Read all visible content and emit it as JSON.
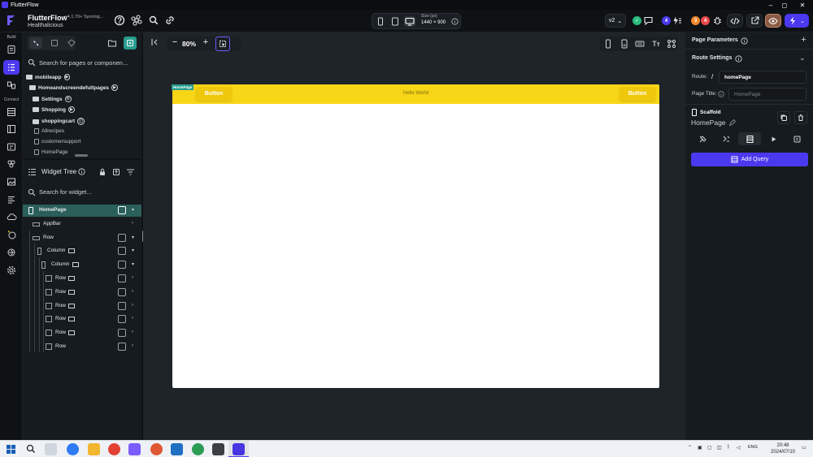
{
  "window": {
    "title": "FlutterFlow",
    "minimize": "–",
    "maximize": "◻",
    "close": "✕"
  },
  "topbar": {
    "brand": "FlutterFlow",
    "version": "v4.1.70+",
    "status": "Syncing...",
    "project": "Healthalicious",
    "size_label": "Size (px)",
    "size_value": "1440 × 900",
    "branch": "v2",
    "badge_1": "4",
    "badge_2": "3",
    "badge_3": "4",
    "colors": {
      "accent": "#4b39ef",
      "green": "#2bbd7e",
      "orange": "#f0892e",
      "red": "#e84a4a"
    }
  },
  "rail": {
    "build_label": "Build",
    "connect_label": "Connect"
  },
  "pages_panel": {
    "search_placeholder": "Search for pages or componen...",
    "items": [
      {
        "label": "mobileapp",
        "kind": "folder"
      },
      {
        "label": "Homeandscreendefultpages",
        "kind": "folder"
      },
      {
        "label": "Settings",
        "kind": "folder"
      },
      {
        "label": "Shopping",
        "kind": "folder"
      },
      {
        "label": "shoppingcart",
        "kind": "folder"
      },
      {
        "label": "Allrecipes",
        "kind": "page"
      },
      {
        "label": "customersupport",
        "kind": "page"
      },
      {
        "label": "HomePage",
        "kind": "page"
      }
    ]
  },
  "widget_tree": {
    "title": "Widget Tree",
    "search_placeholder": "Search for widget...",
    "rows": [
      {
        "label": "HomePage"
      },
      {
        "label": "AppBar"
      },
      {
        "label": "Row"
      },
      {
        "label": "Column"
      },
      {
        "label": "Column"
      },
      {
        "label": "Row"
      },
      {
        "label": "Row"
      },
      {
        "label": "Row"
      },
      {
        "label": "Row"
      },
      {
        "label": "Row"
      },
      {
        "label": "Row"
      }
    ]
  },
  "canvas": {
    "zoom": "80%",
    "page_tag": "HomePage",
    "appbar_button_left": "Button",
    "appbar_title": "Hello World",
    "appbar_button_right": "Button",
    "appbar_color": "#f7d517"
  },
  "right_panel": {
    "page_parameters": "Page Parameters",
    "route_settings": "Route Settings",
    "route_label": "Route:",
    "route_slash": "/",
    "route_value": "homePage",
    "page_title_label": "Page Title:",
    "page_title_placeholder": "HomePage",
    "scaffold_label": "Scaffold",
    "widget_name": "HomePage",
    "add_query": "Add Query"
  },
  "taskbar": {
    "lang": "ENG",
    "time": "20:48",
    "date": "2024/07/10"
  }
}
